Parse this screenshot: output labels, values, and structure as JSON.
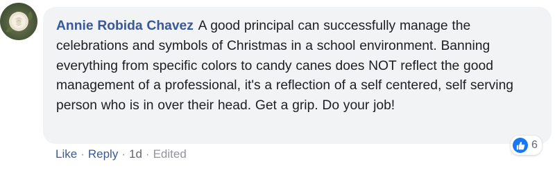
{
  "comment": {
    "author": "Annie Robida Chavez",
    "text": "A good principal can successfully manage the celebrations and symbols of Christmas in a school environment. Banning everything from specific colors to candy canes does NOT reflect the good management of a professional, it's a reflection of a self centered, self serving person who is in over their head. Get a grip. Do your job!"
  },
  "reactions": {
    "type_icon": "like-icon",
    "count": "6",
    "color": "#1877f2"
  },
  "actions": {
    "like_label": "Like",
    "reply_label": "Reply",
    "separator": "·",
    "time": "1d",
    "edited": "Edited"
  },
  "colors": {
    "author": "#385898",
    "bubble": "#f2f3f5",
    "meta": "#90949c"
  }
}
